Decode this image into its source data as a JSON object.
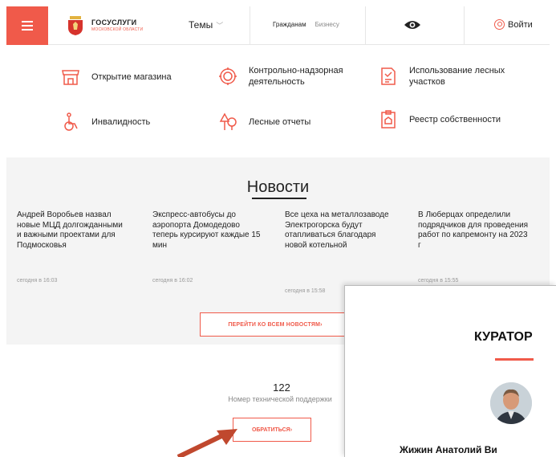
{
  "header": {
    "menu_icon": "hamburger-icon",
    "logo_title": "ГОСУСЛУГИ",
    "logo_subtitle": "МОСКОВСКОЙ ОБЛАСТИ",
    "topics_label": "Темы",
    "tab_citizens": "Гражданам",
    "tab_business": "Бизнесу",
    "accessibility_icon": "eye-icon",
    "login_label": "Войти"
  },
  "services": [
    {
      "label": "Открытие магазина",
      "icon": "shop-icon"
    },
    {
      "label": "Контрольно-надзорная деятельность",
      "icon": "inspection-icon"
    },
    {
      "label": "Использование лесных участков",
      "icon": "forest-document-icon"
    },
    {
      "label": "Инвалидность",
      "icon": "wheelchair-icon"
    },
    {
      "label": "Лесные отчеты",
      "icon": "trees-icon"
    },
    {
      "label": "Реестр собственности",
      "icon": "property-register-icon"
    }
  ],
  "news": {
    "title": "Новости",
    "items": [
      {
        "text": "Андрей Воробьев назвал новые МЦД долгожданными и важными проектами для Подмосковья",
        "date": "сегодня в 16:03"
      },
      {
        "text": "Экспресс-автобусы до аэропорта Домодедово теперь курсируют каждые 15 мин",
        "date": "сегодня в 16:02"
      },
      {
        "text": "Все цеха на металлозаводе Электрогорска будут отапливаться благодаря новой котельной",
        "date": "сегодня в 15:58"
      },
      {
        "text": "В Люберцах определили подрядчиков для проведения работ по капремонту на 2023 г",
        "date": "сегодня в 15:55"
      }
    ],
    "all_news_button": "ПЕРЕЙТИ КО ВСЕМ НОВОСТЯМ"
  },
  "support": {
    "number": "122",
    "label": "Номер технической поддержки",
    "contact_button": "ОБРАТИТЬСЯ"
  },
  "curator": {
    "title": "КУРАТОР",
    "name": "Жижин Анатолий Ви"
  },
  "colors": {
    "accent": "#f05a4a",
    "news_bg": "#f4f4f4",
    "arrow": "#c0482e"
  }
}
